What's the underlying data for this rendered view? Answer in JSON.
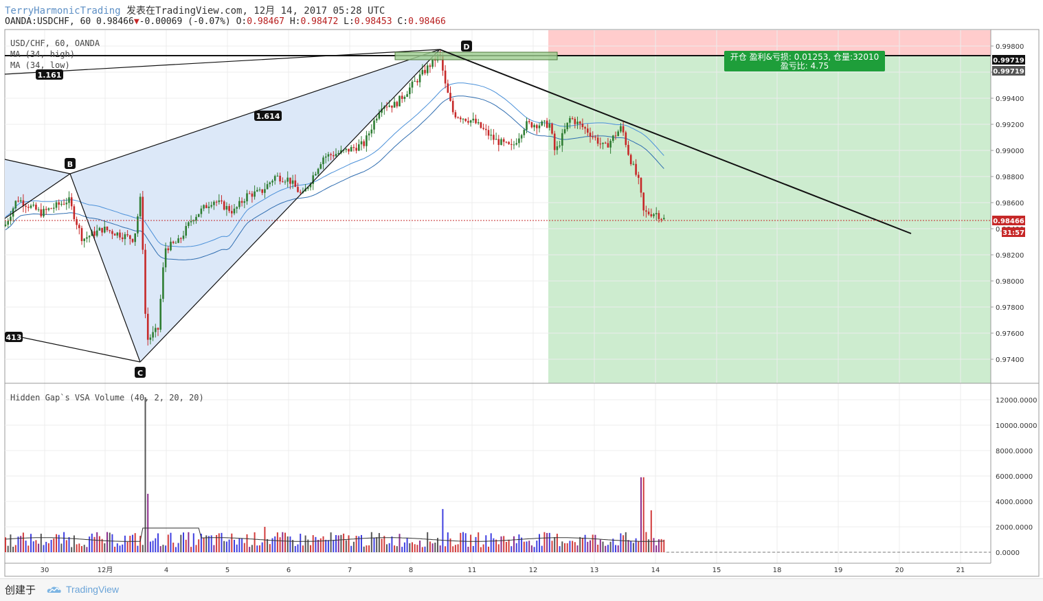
{
  "header": {
    "author": "TerryHarmonicTrading",
    "published_text": "发表在TradingView.com, 12月 14, 2017 05:28 UTC",
    "symbol_text": "OANDA:USDCHF, 60 0.98466",
    "change_text": "-0.00069 (-0.07%)",
    "ohlc": {
      "o_label": "O:",
      "o": "0.98467",
      "h_label": "H:",
      "h": "0.98472",
      "l_label": "L:",
      "l": "0.98453",
      "c_label": "C:",
      "c": "0.98466"
    }
  },
  "legend": {
    "line1": "USD/CHF, 60, OANDA",
    "line2": "MA (34, high)",
    "line3": "MA (34, low)",
    "volume_title": "Hidden Gap`s VSA Volume (40, 2, 20, 20)"
  },
  "pattern_labels": {
    "b": "B",
    "c": "C",
    "d": "D",
    "r1": "1.161",
    "r2": "1.614",
    "r3": "413"
  },
  "trade_box": {
    "line1": "开仓 盈利&亏损: 0.01253, 仓量:32010",
    "line2": "盈亏比: 4.75"
  },
  "price_tags": {
    "p1": "0.99719",
    "p2": "0.99719",
    "current": "0.98466",
    "timer": "31:57"
  },
  "footer": {
    "label": "创建于",
    "logo_text": "TradingView"
  },
  "colors": {
    "up": "#2e7d32",
    "down": "#c62828",
    "ma": "#4a90d9",
    "profit": "#cdeccf",
    "loss": "#ffcccc",
    "pattern": "#dce8f8",
    "trade_label": "#1e9e3a"
  },
  "chart_data": [
    {
      "type": "line",
      "title": "USD/CHF, 60, OANDA",
      "subtype": "candlestick",
      "x_tick_labels": [
        "30",
        "12月",
        "4",
        "5",
        "6",
        "7",
        "8",
        "11",
        "12",
        "13",
        "14",
        "15",
        "18",
        "19",
        "20",
        "21"
      ],
      "y_tick_labels": [
        "0.99800",
        "0.99600",
        "0.99400",
        "0.99200",
        "0.99000",
        "0.98800",
        "0.98600",
        "0.98400",
        "0.98200",
        "0.98000",
        "0.97800",
        "0.97600",
        "0.97400"
      ],
      "ylim": [
        0.9728,
        0.999
      ],
      "series": [
        {
          "name": "MA (34, high)"
        },
        {
          "name": "MA (34, low)"
        }
      ],
      "pattern_points": {
        "B": {
          "x": "12月 1",
          "y": 0.9884
        },
        "C": {
          "x": "12月 4",
          "y": 0.9738
        },
        "D": {
          "x": "12月 8",
          "y": 0.9978
        }
      },
      "trade": {
        "entry": 0.99719,
        "pnl": "0.01253",
        "size": "32010",
        "rr": "4.75"
      },
      "current_price": 0.98466
    },
    {
      "type": "bar",
      "title": "Hidden Gap`s VSA Volume (40, 2, 20, 20)",
      "y_tick_labels": [
        "12000.0000",
        "10000.0000",
        "8000.0000",
        "6000.0000",
        "4000.0000",
        "2000.0000",
        "0.0000"
      ],
      "ylim": [
        0,
        12000
      ],
      "notable_values": [
        12200,
        4600,
        3400,
        5900,
        3300,
        2000
      ]
    }
  ]
}
